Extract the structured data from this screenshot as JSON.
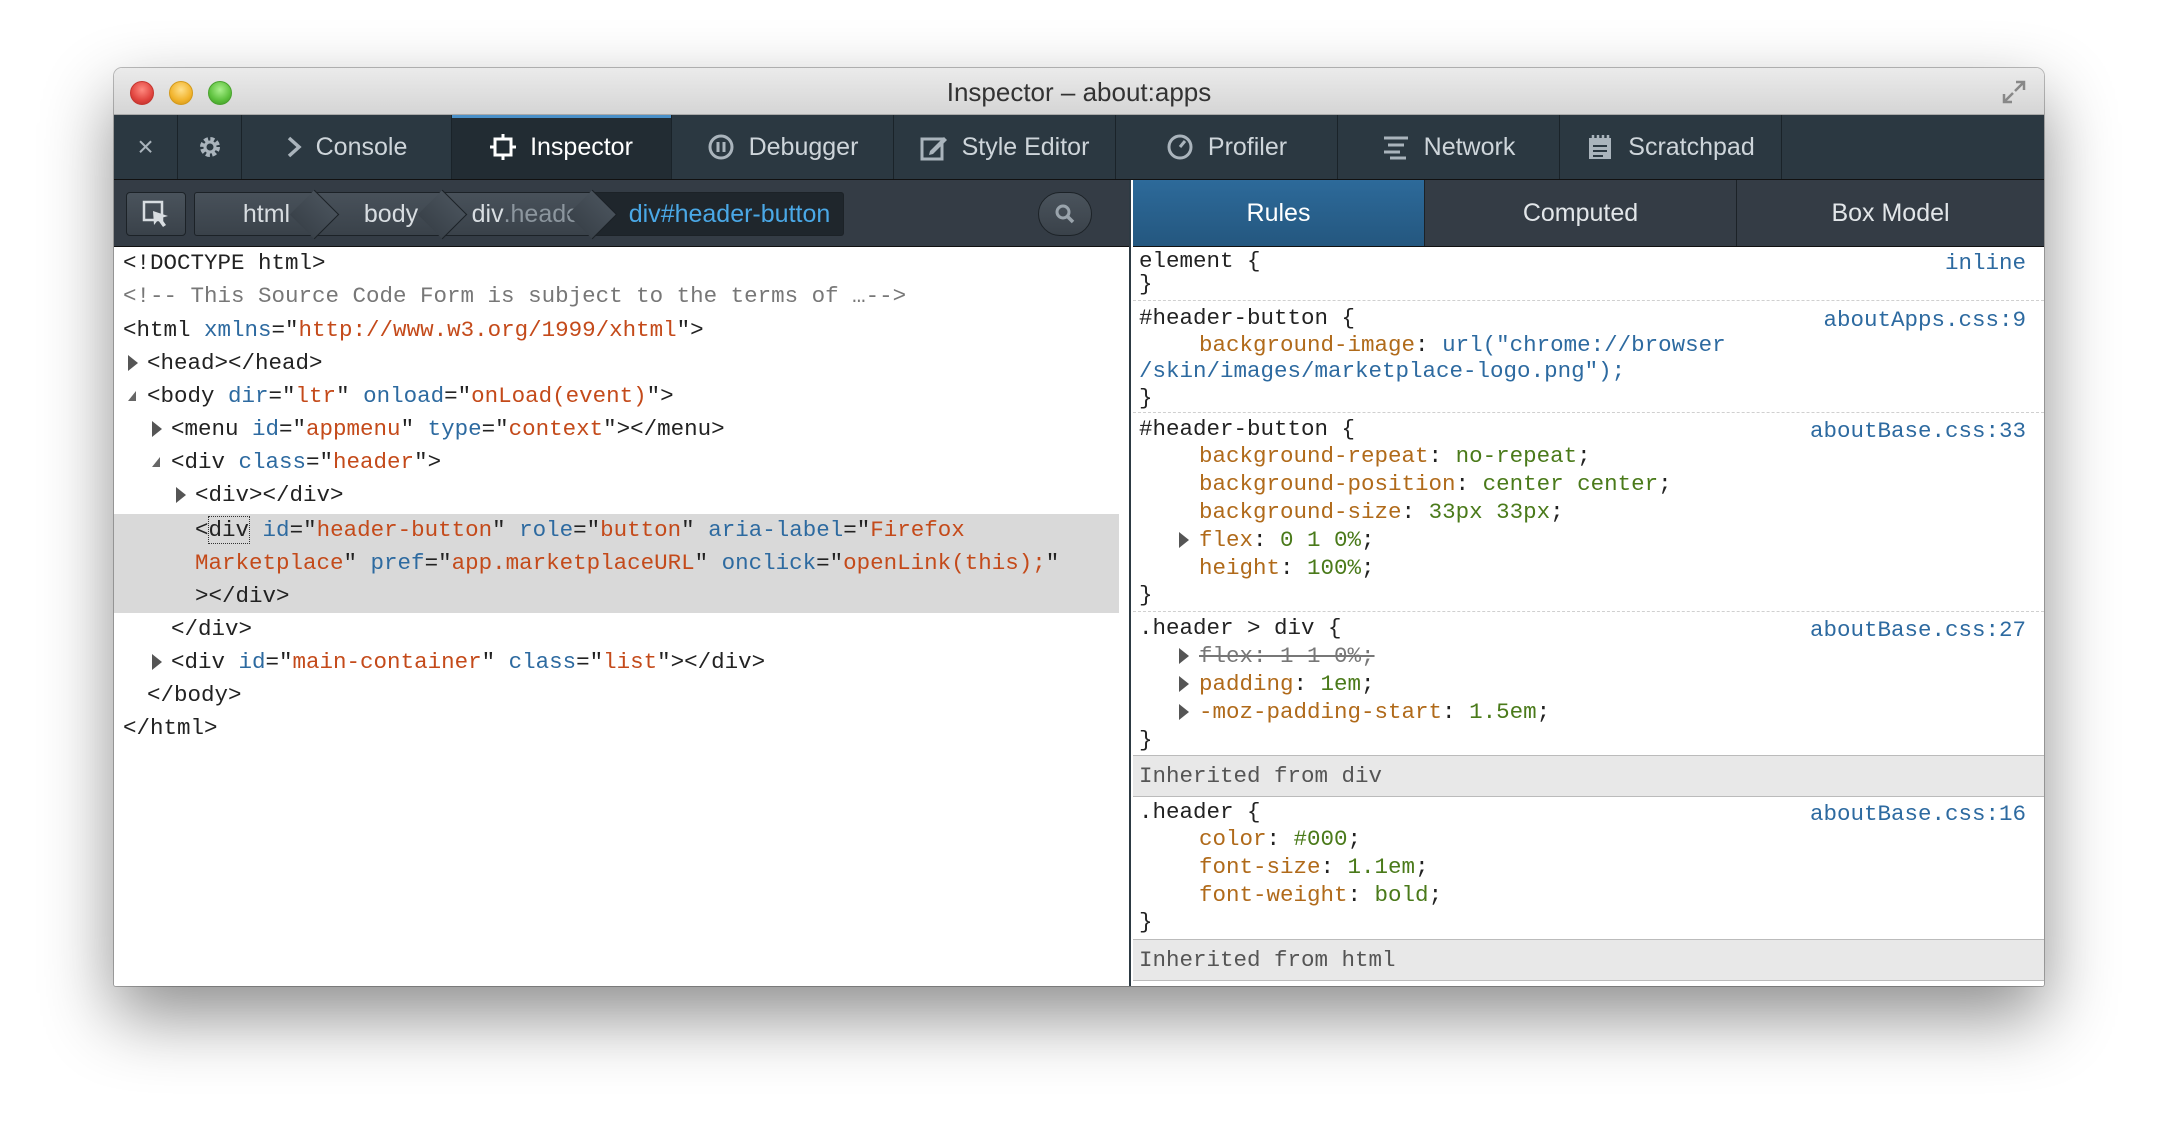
{
  "window": {
    "title": "Inspector – about:apps"
  },
  "toolbar": {
    "close_glyph": "×",
    "tabs": [
      {
        "label": "Console"
      },
      {
        "label": "Inspector"
      },
      {
        "label": "Debugger"
      },
      {
        "label": "Style Editor"
      },
      {
        "label": "Profiler"
      },
      {
        "label": "Network"
      },
      {
        "label": "Scratchpad"
      }
    ]
  },
  "breadcrumbs": [
    {
      "tag": "html",
      "suffix": ""
    },
    {
      "tag": "body",
      "suffix": ""
    },
    {
      "tag": "div",
      "suffix": ".header"
    },
    {
      "tag": "div",
      "suffix": "#header-button"
    }
  ],
  "markup": {
    "doctype": "<!DOCTYPE html>",
    "comment": "<!-- This Source Code Form is subject to the terms of …-->",
    "html_ns": "http://www.w3.org/1999/xhtml",
    "head": "<head></head>",
    "body_dir": "ltr",
    "body_onload": "onLoad(event)",
    "menu_id": "appmenu",
    "menu_type": "context",
    "header_class": "header",
    "inner_div": "<div></div>",
    "sel_id": "header-button",
    "sel_role": "button",
    "sel_aria_1": "Firefox",
    "sel_aria_2": "Marketplace",
    "sel_pref": "app.marketplaceURL",
    "sel_onclick": "openLink(this);",
    "close_div": "</div>",
    "main_id": "main-container",
    "main_class": "list",
    "close_body": "</body>",
    "close_html": "</html>"
  },
  "sidebar_tabs": [
    {
      "label": "Rules"
    },
    {
      "label": "Computed"
    },
    {
      "label": "Box Model"
    }
  ],
  "rules": {
    "r1_selector": "element {",
    "r1_source": "inline",
    "r2_selector": "#header-button {",
    "r2_source": "aboutApps.css:9",
    "r2_p1_name": "background-image",
    "r2_p1_val_a": "url(\"chrome://browser",
    "r2_p1_val_b": "/skin/images/marketplace-logo.png\");",
    "r3_selector": "#header-button {",
    "r3_source": "aboutBase.css:33",
    "r3_p1_name": "background-repeat",
    "r3_p1_val": "no-repeat",
    "r3_p2_name": "background-position",
    "r3_p2_val": "center center",
    "r3_p3_name": "background-size",
    "r3_p3_val": "33px 33px",
    "r3_p4_name": "flex",
    "r3_p4_val": "0 1 0%",
    "r3_p5_name": "height",
    "r3_p5_val": "100%",
    "r4_selector": ".header > div {",
    "r4_source": "aboutBase.css:27",
    "r4_p1": "flex: 1 1 0%;",
    "r4_p2_name": "padding",
    "r4_p2_val": "1em",
    "r4_p3_name": "-moz-padding-start",
    "r4_p3_val": "1.5em",
    "inherited_div": "Inherited from div",
    "r5_selector": ".header {",
    "r5_source": "aboutBase.css:16",
    "r5_p1_name": "color",
    "r5_p1_val": "#000",
    "r5_p2_name": "font-size",
    "r5_p2_val": "1.1em",
    "r5_p3_name": "font-weight",
    "r5_p3_val": "bold",
    "inherited_html": "Inherited from html",
    "close_brace": "}"
  }
}
